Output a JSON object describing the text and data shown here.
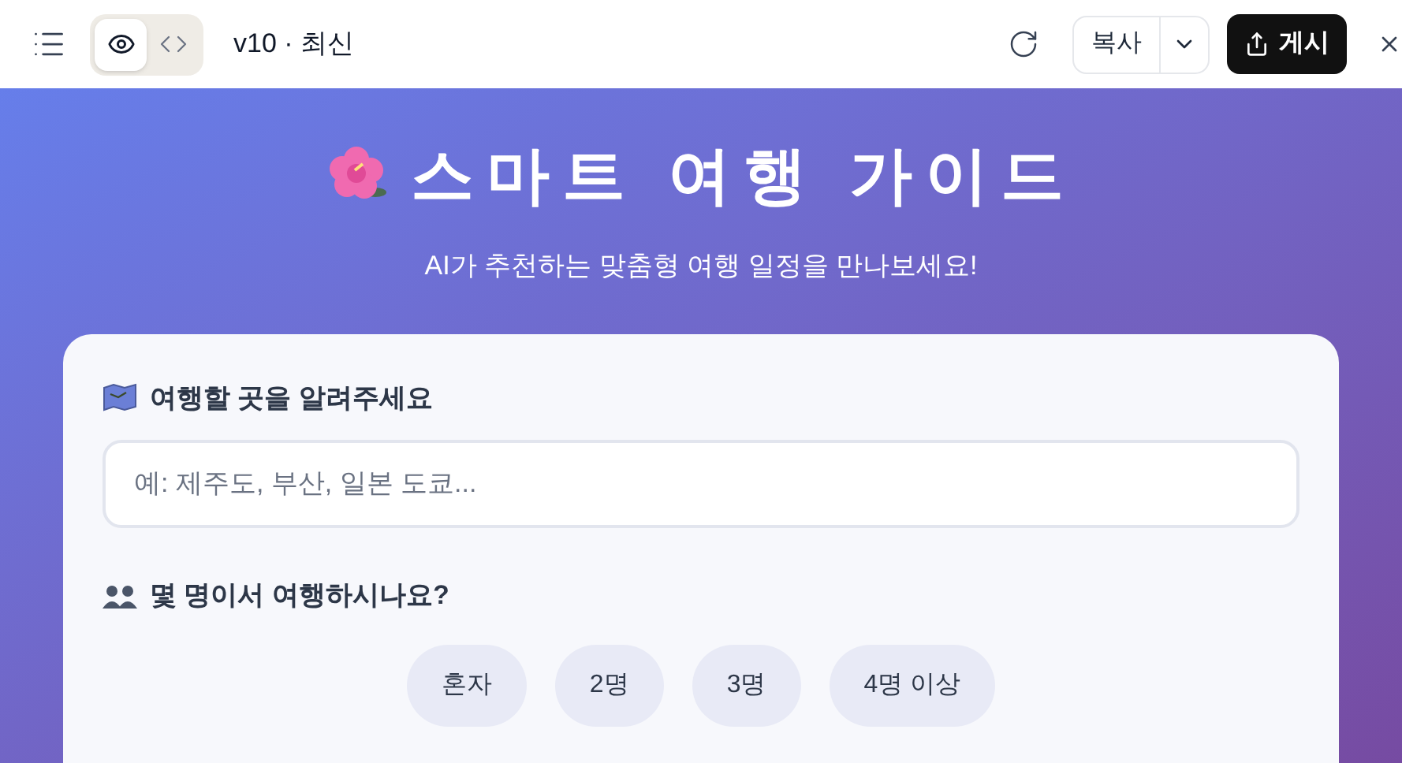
{
  "toolbar": {
    "view_toggle": [
      {
        "kind": "preview",
        "selected": true
      },
      {
        "kind": "code",
        "selected": false
      }
    ],
    "version": "v10 · 최신",
    "copy_button": "복사",
    "publish_button": "게시"
  },
  "hero": {
    "title": "스마트 여행 가이드",
    "subtitle": "AI가 추천하는 맞춤형 여행 일정을 만나보세요!"
  },
  "form": {
    "destination": {
      "label": "여행할 곳을 알려주세요",
      "placeholder": "예: 제주도, 부산, 일본 도쿄..."
    },
    "travelers": {
      "label": "몇 명이서 여행하시나요?",
      "options": [
        {
          "label": "혼자",
          "selected": false
        },
        {
          "label": "2명",
          "selected": false
        },
        {
          "label": "3명",
          "selected": false
        },
        {
          "label": "4명 이상",
          "selected": false
        }
      ]
    }
  }
}
